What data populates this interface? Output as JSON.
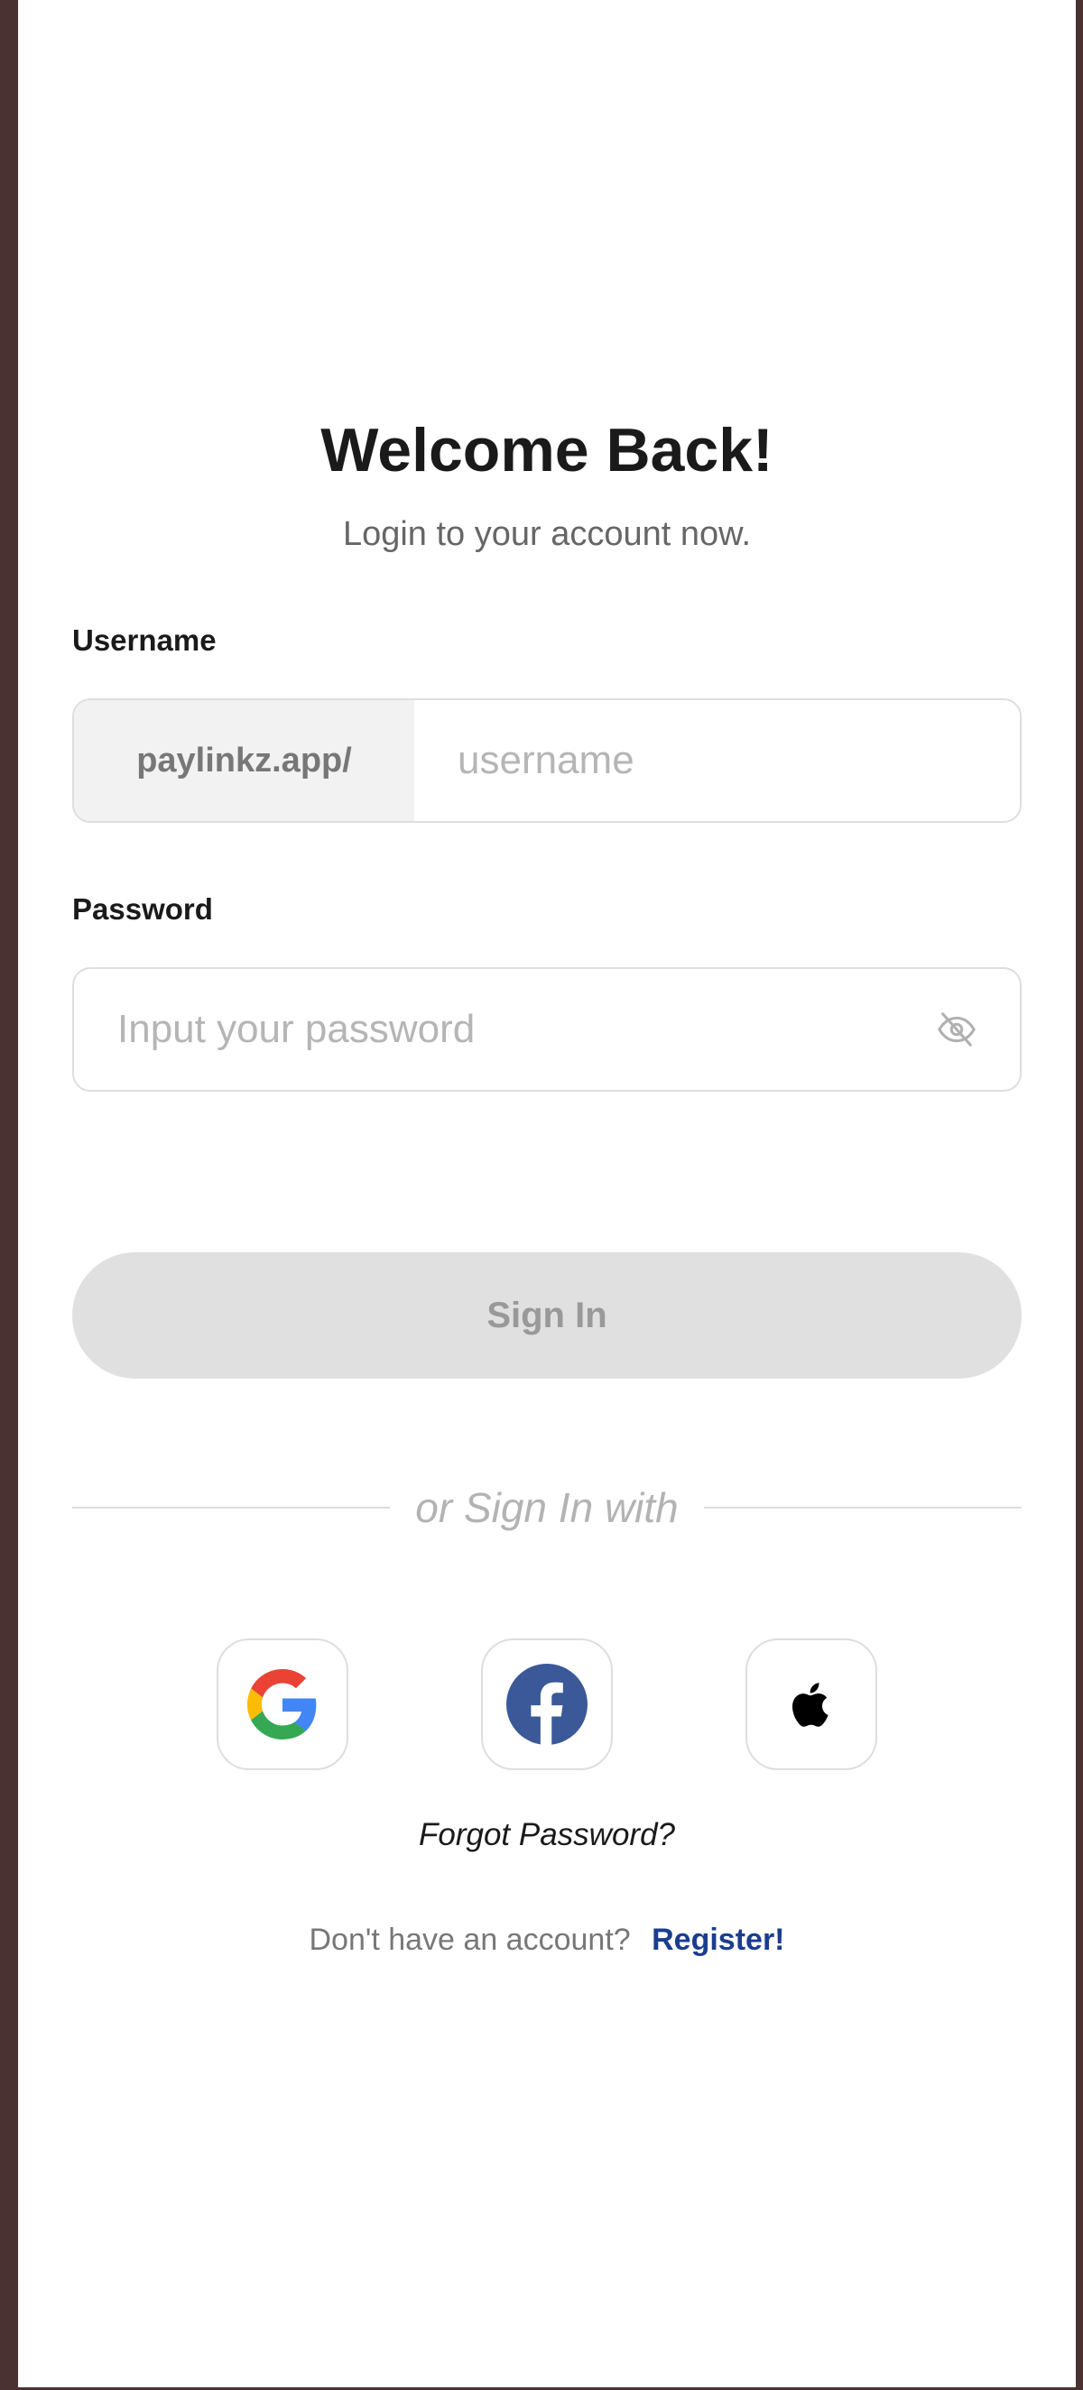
{
  "header": {
    "title": "Welcome Back!",
    "subtitle": "Login to your account now."
  },
  "username": {
    "label": "Username",
    "prefix": "paylinkz.app/",
    "placeholder": "username",
    "value": ""
  },
  "password": {
    "label": "Password",
    "placeholder": "Input your password",
    "value": "",
    "toggle_icon": "eye-off-icon"
  },
  "signin": {
    "label": "Sign In",
    "state": "disabled"
  },
  "divider": {
    "text": "or Sign In with"
  },
  "social": [
    {
      "provider": "google",
      "icon": "google-icon"
    },
    {
      "provider": "facebook",
      "icon": "facebook-icon"
    },
    {
      "provider": "apple",
      "icon": "apple-icon"
    }
  ],
  "links": {
    "forgot_password": "Forgot Password?",
    "register_prompt": "Don't have an account?",
    "register_label": "Register!"
  },
  "colors": {
    "background_frame": "#4a3232",
    "surface": "#ffffff",
    "input_border": "#dedede",
    "prefix_background": "#f2f2f2",
    "button_disabled_bg": "#e0e0e0",
    "button_disabled_text": "#999999",
    "link_accent": "#1b3d8f",
    "facebook_blue": "#3b5998"
  }
}
